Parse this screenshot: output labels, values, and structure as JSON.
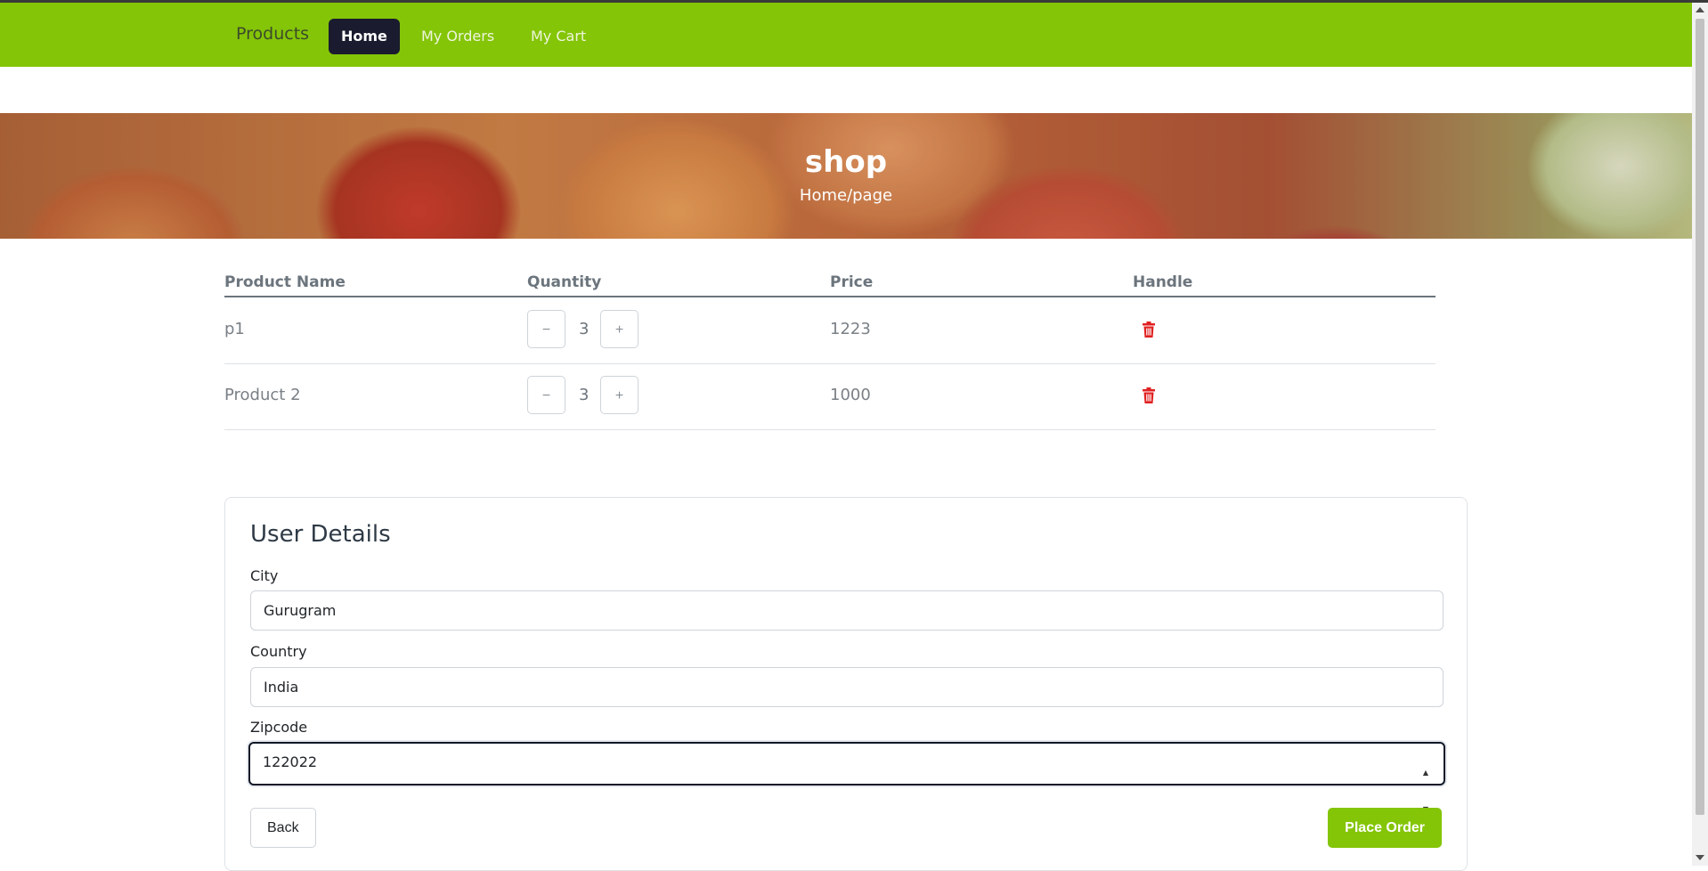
{
  "navbar": {
    "brand": "Products",
    "links": [
      {
        "label": "Home",
        "active": true
      },
      {
        "label": "My Orders",
        "active": false
      },
      {
        "label": "My Cart",
        "active": false
      }
    ]
  },
  "hero": {
    "title": "shop",
    "breadcrumb": "Home/page"
  },
  "cart_table": {
    "headers": [
      "Product Name",
      "Quantity",
      "Price",
      "Handle"
    ],
    "rows": [
      {
        "name": "p1",
        "quantity": "3",
        "price": "1223"
      },
      {
        "name": "Product 2",
        "quantity": "3",
        "price": "1000"
      }
    ],
    "decrement_symbol": "−",
    "increment_symbol": "+",
    "delete_icon": "trash-icon"
  },
  "user_details": {
    "title": "User Details",
    "fields": {
      "city": {
        "label": "City",
        "value": "Gurugram"
      },
      "country": {
        "label": "Country",
        "value": "India"
      },
      "zipcode": {
        "label": "Zipcode",
        "value": "122022"
      }
    },
    "back_label": "Back",
    "place_order_label": "Place Order"
  },
  "colors": {
    "brand_green": "#84c508",
    "nav_active": "#1a1b2e",
    "delete_red": "#e02020"
  }
}
